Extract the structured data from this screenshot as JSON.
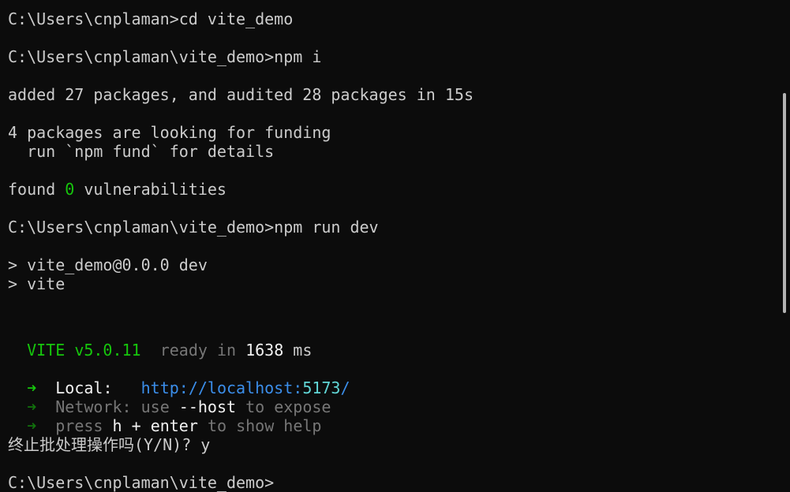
{
  "terminal": {
    "line1": "C:\\Users\\cnplaman>cd vite_demo",
    "line2": "C:\\Users\\cnplaman\\vite_demo>npm i",
    "line3": "added 27 packages, and audited 28 packages in 15s",
    "line4": "4 packages are looking for funding",
    "line5": "  run `npm fund` for details",
    "line6_a": "found ",
    "line6_b": "0",
    "line6_c": " vulnerabilities",
    "line7": "C:\\Users\\cnplaman\\vite_demo>npm run dev",
    "line8": "> vite_demo@0.0.0 dev",
    "line9": "> vite",
    "vite_name": "VITE",
    "vite_version": "v5.0.11",
    "ready_in": "ready in",
    "ready_ms_value": "1638",
    "ready_ms_unit": "ms",
    "arrow": "➜",
    "local_label": "Local:",
    "local_url_prefix": "http://localhost:",
    "local_url_port": "5173",
    "local_url_suffix": "/",
    "network_label": "Network:",
    "network_use": "use",
    "network_flag": "--host",
    "network_rest": "to expose",
    "press_label": "press",
    "press_key1": "h",
    "press_plus": "+",
    "press_key2": "enter",
    "press_rest": "to show help",
    "batch_prompt": "终止批处理操作吗(Y/N)? y",
    "final_prompt": "C:\\Users\\cnplaman\\vite_demo>"
  },
  "colors": {
    "background": "#0c0c0c",
    "text": "#cccccc",
    "green": "#16c60c",
    "dim": "#767676",
    "url": "#3b8eea",
    "port": "#61d6d6"
  }
}
